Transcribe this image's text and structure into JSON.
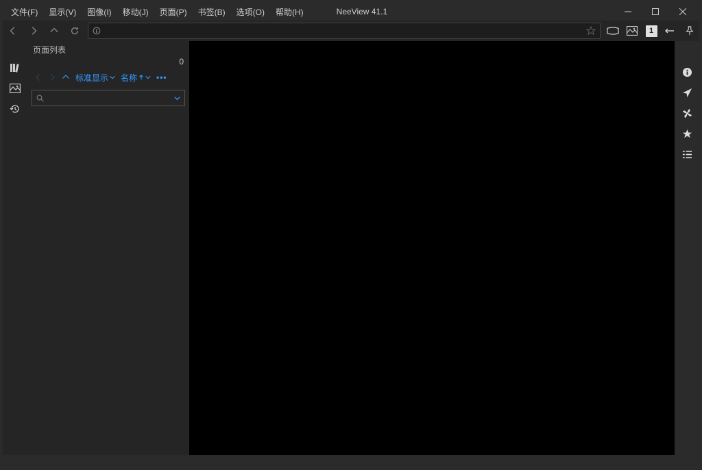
{
  "app": {
    "title": "NeeView 41.1"
  },
  "menu": {
    "file": "文件(F)",
    "view": "显示(V)",
    "image": "图像(I)",
    "move": "移动(J)",
    "page": "页面(P)",
    "bookmark": "书签(B)",
    "option": "选项(O)",
    "help": "帮助(H)"
  },
  "toolbar": {
    "address_value": "",
    "page_number": "1"
  },
  "sidebar": {
    "title": "页面列表",
    "count": "0",
    "display_mode": "标准显示",
    "sort_mode": "名称",
    "search_value": ""
  }
}
